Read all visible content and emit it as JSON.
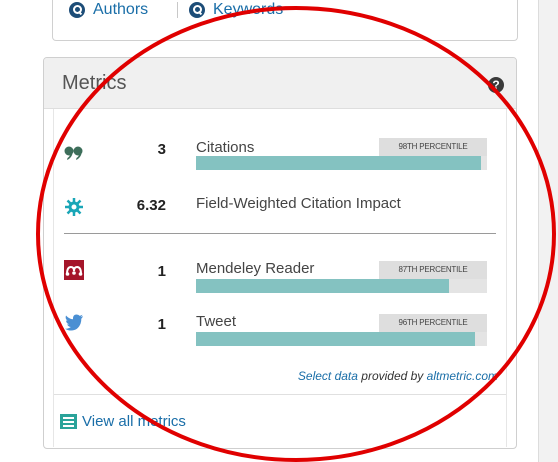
{
  "search_links": [
    {
      "label": "Authors",
      "icon": "search-icon"
    },
    {
      "label": "Keywords",
      "icon": "search-icon"
    }
  ],
  "metrics": {
    "title": "Metrics",
    "help": "?",
    "rows": [
      {
        "icon": "quote-icon",
        "value": "3",
        "label": "Citations",
        "percentile": "98TH PERCENTILE",
        "bar_fraction": 0.98
      },
      {
        "icon": "fwci-icon",
        "value": "6.32",
        "label": "Field-Weighted Citation Impact"
      },
      {
        "icon": "mendeley-icon",
        "value": "1",
        "label": "Mendeley Reader",
        "percentile": "87TH PERCENTILE",
        "bar_fraction": 0.87
      },
      {
        "icon": "twitter-icon",
        "value": "1",
        "label": "Tweet",
        "percentile": "96TH PERCENTILE",
        "bar_fraction": 0.96
      }
    ],
    "attribution": {
      "link": "Select data",
      "middle": " provided by ",
      "source": "altmetric.com"
    },
    "view_all": "View all metrics"
  },
  "colors": {
    "bar_fill": "#84c2c1",
    "link": "#1a6ea8",
    "annotation_ellipse": "#e00000"
  }
}
